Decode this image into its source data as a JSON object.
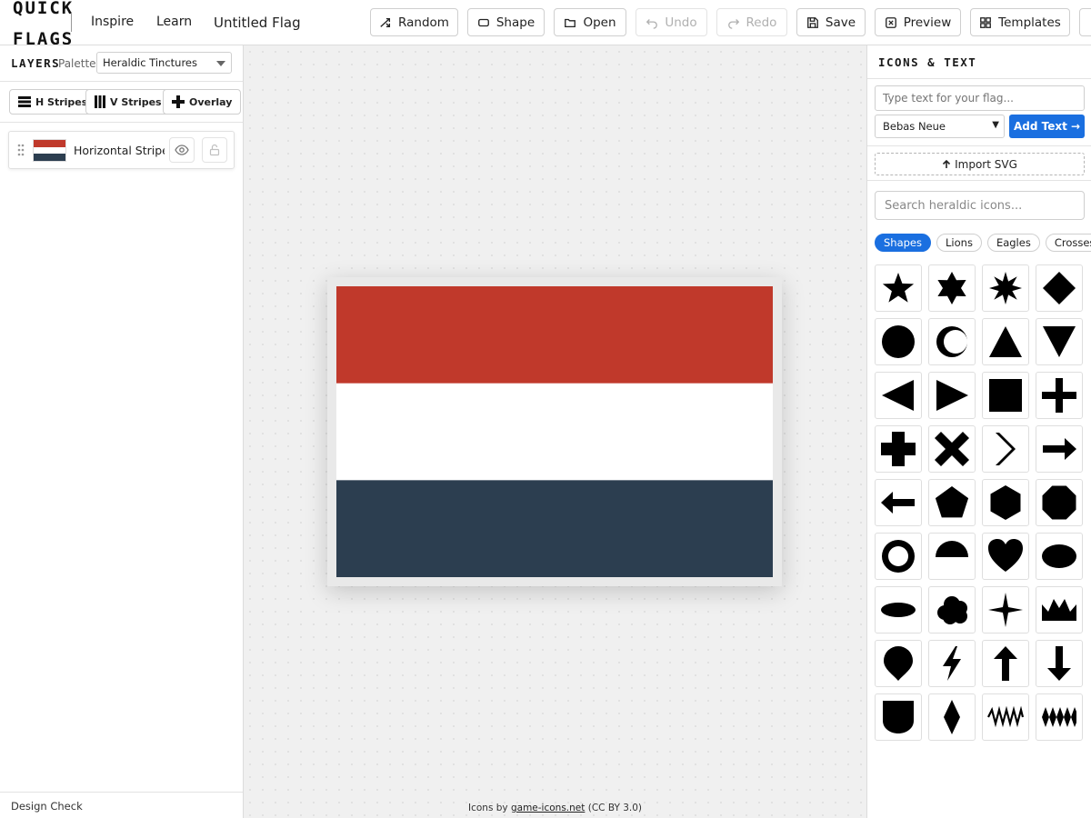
{
  "app": {
    "logo_line1": "QUICK",
    "logo_line2": "FLAGS",
    "nav": [
      "Inspire",
      "Learn"
    ],
    "flag_title": "Untitled Flag"
  },
  "toolbar": {
    "random": "Random",
    "shape": "Shape",
    "open": "Open",
    "undo": "Undo",
    "redo": "Redo",
    "save": "Save",
    "preview": "Preview",
    "templates": "Templates"
  },
  "layers_panel": {
    "title": "LAYERS",
    "palette_label": "Palette",
    "palette_value": "Heraldic Tinctures",
    "add_buttons": [
      "H Stripes",
      "V Stripes",
      "Overlay"
    ],
    "layers": [
      {
        "name": "Horizontal Stripes",
        "colors": [
          "#c0392b",
          "#ffffff",
          "#2c3e50"
        ]
      }
    ],
    "design_check": "Design Check"
  },
  "canvas": {
    "flag_stripes": [
      "#c0392b",
      "#ffffff",
      "#2c3e50"
    ],
    "credit_prefix": "Icons by",
    "credit_link": "game-icons.net",
    "credit_suffix": "(CC BY 3.0)"
  },
  "icons_panel": {
    "title": "ICONS & TEXT",
    "text_placeholder": "Type text for your flag...",
    "font_value": "Bebas Neue",
    "add_text": "Add Text →",
    "import_svg": "Import SVG",
    "search_placeholder": "Search heraldic icons...",
    "categories": [
      "Shapes",
      "Lions",
      "Eagles",
      "Crosses"
    ],
    "active_category": "Shapes",
    "icons": [
      "star-5-icon",
      "star-6-icon",
      "star-burst-icon",
      "diamond-icon",
      "circle-icon",
      "crescent-icon",
      "triangle-up-icon",
      "triangle-down-icon",
      "triangle-left-icon",
      "triangle-right-icon",
      "square-icon",
      "plus-icon",
      "thick-cross-icon",
      "x-cross-icon",
      "chevron-right-icon",
      "arrow-right-icon",
      "arrow-left-icon",
      "pentagon-icon",
      "hexagon-icon",
      "octagon-icon",
      "ring-icon",
      "semicircle-icon",
      "heart-icon",
      "ellipse-icon",
      "flat-ellipse-icon",
      "cloud-icon",
      "four-point-star-icon",
      "crown-icon",
      "drop-icon",
      "lightning-icon",
      "arrow-up-icon",
      "arrow-down-icon",
      "shield-icon",
      "lozenge-icon",
      "wave-icon",
      "zigzag-icon"
    ]
  }
}
